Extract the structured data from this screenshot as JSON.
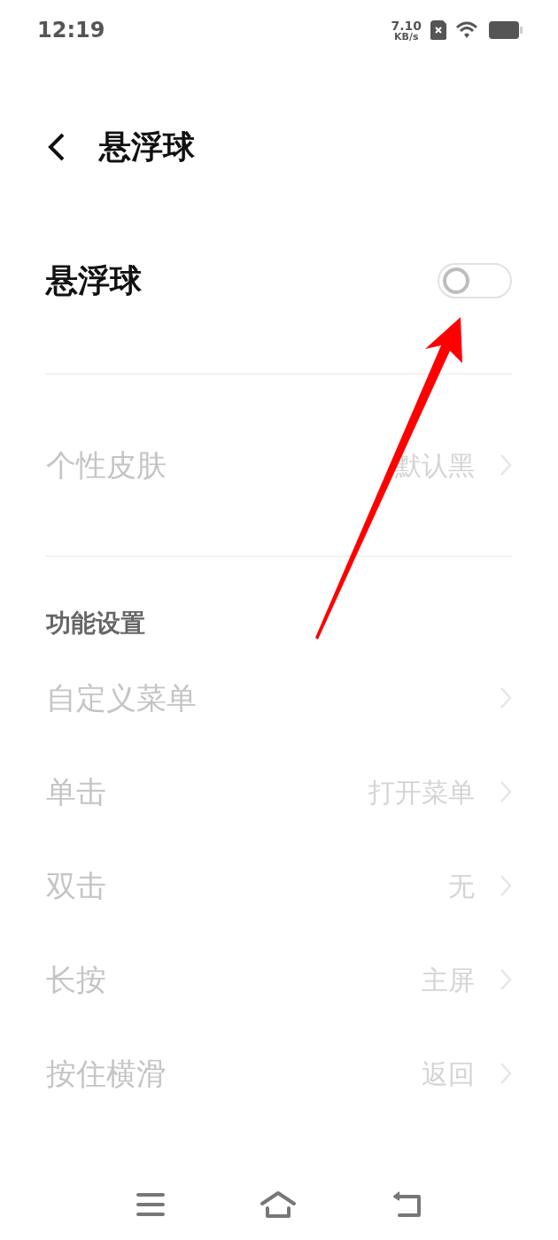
{
  "status_bar": {
    "time": "12:19",
    "speed": "7.10",
    "speed_unit": "KB/s"
  },
  "header": {
    "title": "悬浮球"
  },
  "main_toggle": {
    "label": "悬浮球",
    "on": false
  },
  "skin": {
    "label": "个性皮肤",
    "value": "默认黑",
    "disabled": true
  },
  "section": {
    "title": "功能设置",
    "rows": [
      {
        "label": "自定义菜单",
        "disabled": true
      },
      {
        "label": "单击",
        "value": "打开菜单",
        "disabled": true
      },
      {
        "label": "双击",
        "value": "无",
        "disabled": true
      },
      {
        "label": "长按",
        "value": "主屏",
        "disabled": true
      },
      {
        "label": "按住横滑",
        "value": "返回",
        "disabled": true
      }
    ]
  }
}
